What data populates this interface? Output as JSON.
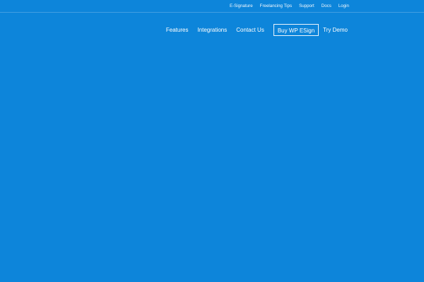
{
  "utility_nav": {
    "links": [
      "E-Signature",
      "Freelancing Tips",
      "Support",
      "Docs",
      "Login"
    ]
  },
  "main_nav": {
    "features": "Features",
    "integrations": "Integrations",
    "contact": "Contact Us",
    "buy": "Buy WP ESign",
    "demo": "Try Demo"
  }
}
